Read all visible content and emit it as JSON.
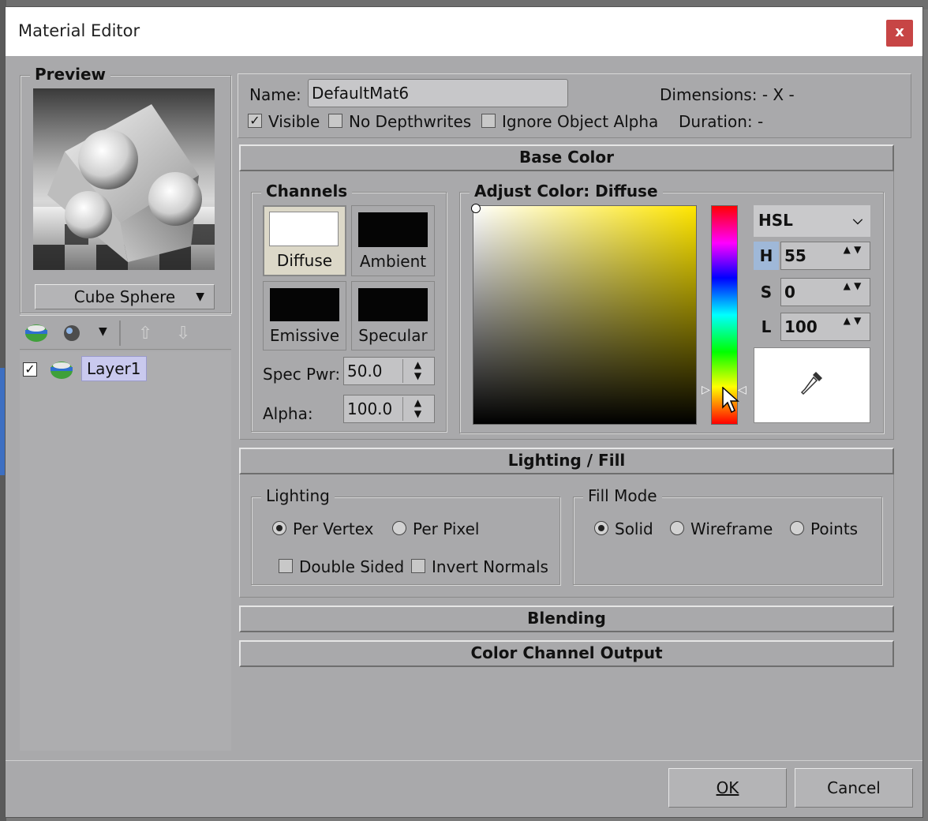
{
  "window": {
    "title": "Material Editor",
    "close_label": "x"
  },
  "preview": {
    "title": "Preview",
    "shape_select": "Cube Sphere"
  },
  "layers": {
    "items": [
      {
        "label": "Layer1",
        "checked": true
      }
    ]
  },
  "general": {
    "name_label": "Name:",
    "name_value": "DefaultMat6",
    "dimensions_label": "Dimensions: - X -",
    "duration_label": "Duration: -",
    "visible_label": "Visible",
    "visible_checked": true,
    "no_depthwrites_label": "No Depthwrites",
    "no_depthwrites_checked": false,
    "ignore_alpha_label": "Ignore Object Alpha",
    "ignore_alpha_checked": false
  },
  "base_color": {
    "header": "Base Color",
    "channels_title": "Channels",
    "channels": [
      {
        "label": "Diffuse",
        "color": "#ffffff",
        "selected": true
      },
      {
        "label": "Ambient",
        "color": "#050505",
        "selected": false
      },
      {
        "label": "Emissive",
        "color": "#050505",
        "selected": false
      },
      {
        "label": "Specular",
        "color": "#050505",
        "selected": false
      }
    ],
    "spec_pwr_label": "Spec Pwr:",
    "spec_pwr_value": "50.0",
    "alpha_label": "Alpha:",
    "alpha_value": "100.0",
    "adjust_title": "Adjust Color: Diffuse",
    "mode": "HSL",
    "h_label": "H",
    "h_value": "55",
    "s_label": "S",
    "s_value": "0",
    "l_label": "L",
    "l_value": "100",
    "hue_color": "#ffe600"
  },
  "lighting_fill": {
    "header": "Lighting / Fill",
    "lighting_title": "Lighting",
    "per_vertex_label": "Per Vertex",
    "per_pixel_label": "Per Pixel",
    "lighting_selected": "Per Vertex",
    "double_sided_label": "Double Sided",
    "invert_normals_label": "Invert Normals",
    "fill_title": "Fill Mode",
    "solid_label": "Solid",
    "wireframe_label": "Wireframe",
    "points_label": "Points",
    "fill_selected": "Solid"
  },
  "blending": {
    "header": "Blending"
  },
  "color_output": {
    "header": "Color Channel Output"
  },
  "footer": {
    "ok_label": "OK",
    "cancel_label": "Cancel"
  }
}
